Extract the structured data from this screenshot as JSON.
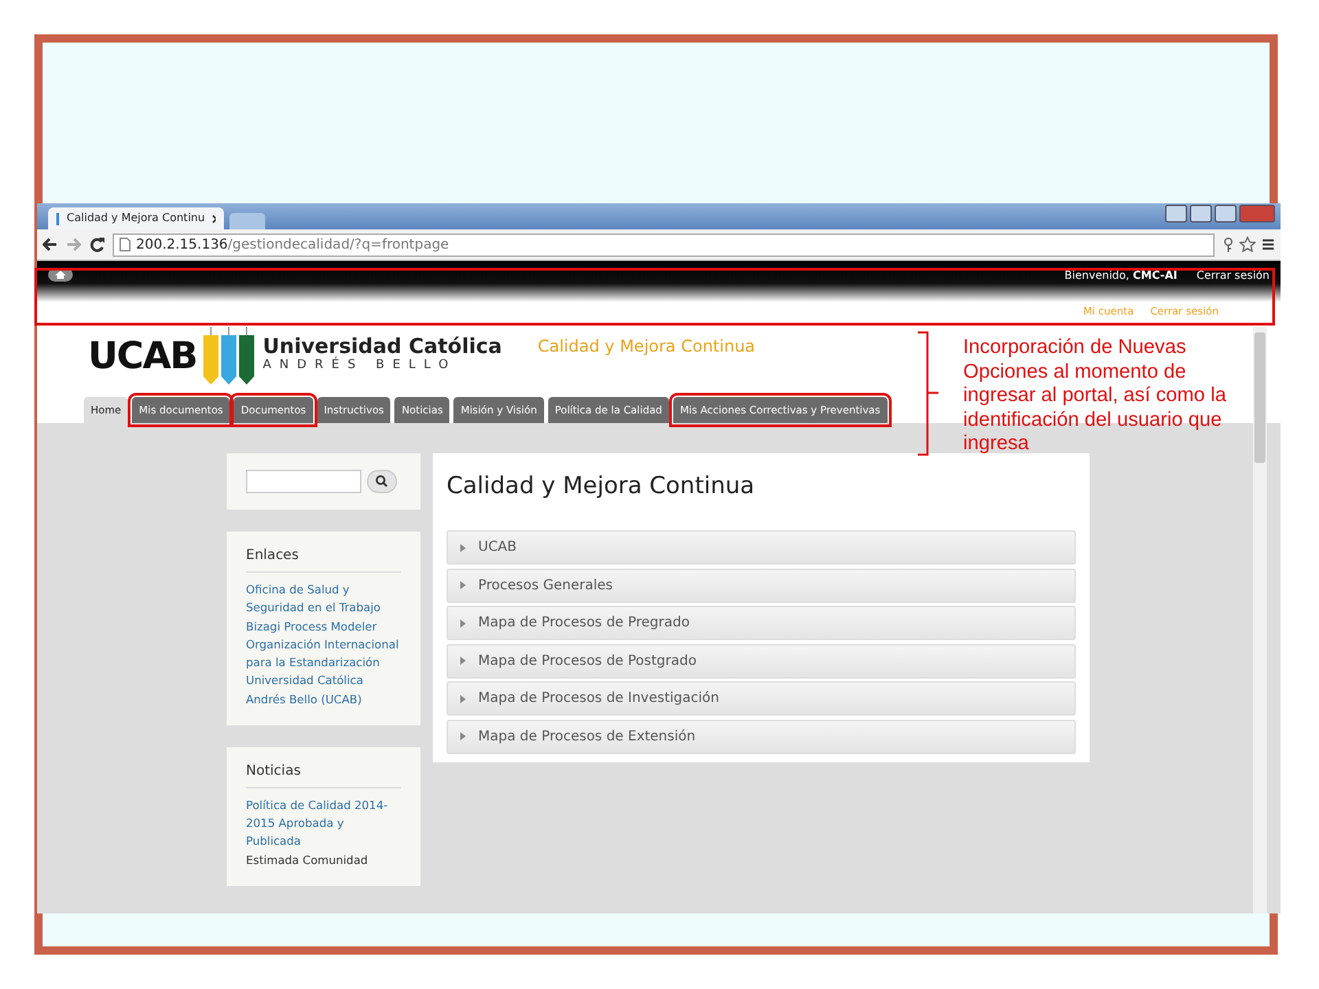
{
  "browser": {
    "tab_title": "Calidad y Mejora Continu",
    "url_host": "200.2.15.136",
    "url_path": "/gestiondecalidad/?q=frontpage"
  },
  "site": {
    "welcome": "Bienvenido,",
    "user": "CMC-AI",
    "top_logout": "Cerrar sesión",
    "user_links": [
      "Mi cuenta",
      "Cerrar sesión"
    ],
    "logo": {
      "mark": "UCAB",
      "name": "Universidad Católica",
      "sub": "ANDRÉS BELLO"
    },
    "site_name": "Calidad y Mejora Continua",
    "tabs": [
      {
        "label": "Home",
        "selected": true,
        "annotated": false
      },
      {
        "label": "Mis documentos",
        "selected": false,
        "annotated": true
      },
      {
        "label": "Documentos",
        "selected": false,
        "annotated": true
      },
      {
        "label": "Instructivos",
        "selected": false,
        "annotated": false
      },
      {
        "label": "Noticias",
        "selected": false,
        "annotated": false
      },
      {
        "label": "Misión y Visión",
        "selected": false,
        "annotated": false
      },
      {
        "label": "Política de la Calidad",
        "selected": false,
        "annotated": false
      },
      {
        "label": "Mis Acciones Correctivas y Preventivas",
        "selected": false,
        "annotated": true
      }
    ],
    "blocks": [
      {
        "title": "Enlaces",
        "items": [
          {
            "kind": "link",
            "text": "Oficina de Salud y Seguridad en el Trabajo"
          },
          {
            "kind": "link",
            "text": "Bizagi Process Modeler"
          },
          {
            "kind": "link",
            "text": "Organización Internacional para la Estandarización"
          },
          {
            "kind": "link",
            "text": "Universidad Católica Andrés Bello (UCAB)"
          }
        ]
      },
      {
        "title": "Noticias",
        "items": [
          {
            "kind": "link",
            "text": "Política de Calidad 2014-2015 Aprobada y Publicada"
          },
          {
            "kind": "text",
            "text": "Estimada Comunidad"
          }
        ]
      }
    ],
    "content": {
      "title": "Calidad y Mejora Continua",
      "sections": [
        {
          "label": "UCAB",
          "expanded": false
        },
        {
          "label": "Procesos Generales",
          "expanded": false
        },
        {
          "label": "Mapa de Procesos de Pregrado",
          "expanded": false
        },
        {
          "label": "Mapa de Procesos de Postgrado",
          "expanded": false
        },
        {
          "label": "Mapa de Procesos de Investigación",
          "expanded": false
        },
        {
          "label": "Mapa de Procesos de Extensión",
          "expanded": false
        }
      ]
    }
  },
  "annotation": {
    "text": "Incorporación de Nuevas Opciones al momento de ingresar al portal, así como la identificación del usuario que ingresa"
  }
}
